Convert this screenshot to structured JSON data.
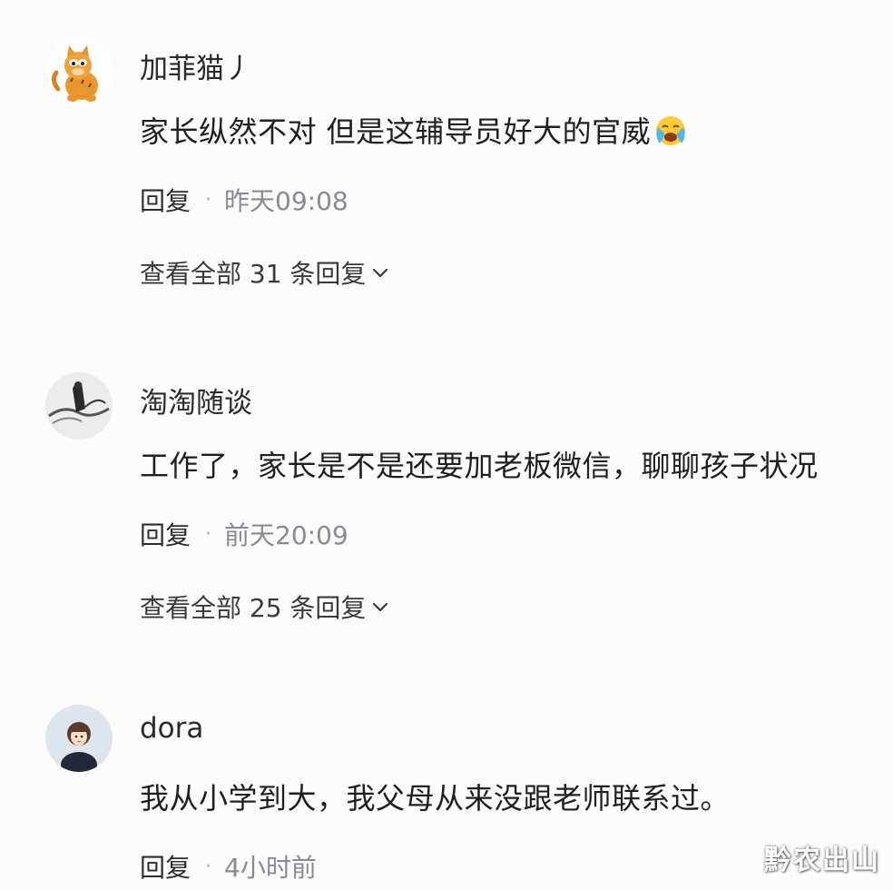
{
  "comments": [
    {
      "avatar_icon": "garfield-avatar-icon",
      "username": "加菲猫丿",
      "text": "家长纵然不对 但是这辅导员好大的官威",
      "emoji_icon": "crying-face-emoji-icon",
      "reply_label": "回复",
      "separator": "·",
      "time": "昨天09:08",
      "view_all": "查看全部 31 条回复"
    },
    {
      "avatar_icon": "ink-painting-avatar-icon",
      "username": "淘淘随谈",
      "text": "工作了，家长是不是还要加老板微信，聊聊孩子状况",
      "reply_label": "回复",
      "separator": "·",
      "time": "前天20:09",
      "view_all": "查看全部 25 条回复"
    },
    {
      "avatar_icon": "girl-portrait-avatar-icon",
      "username": "dora",
      "text": "我从小学到大，我父母从来没跟老师联系过。",
      "reply_label": "回复",
      "separator": "·",
      "time": "4小时前"
    }
  ],
  "watermark": "黔农出山",
  "colors": {
    "background": "#fcfcfd",
    "text": "#1f1f1f",
    "meta_gray": "#8a8a92",
    "garfield_orange": "#e8962e"
  }
}
